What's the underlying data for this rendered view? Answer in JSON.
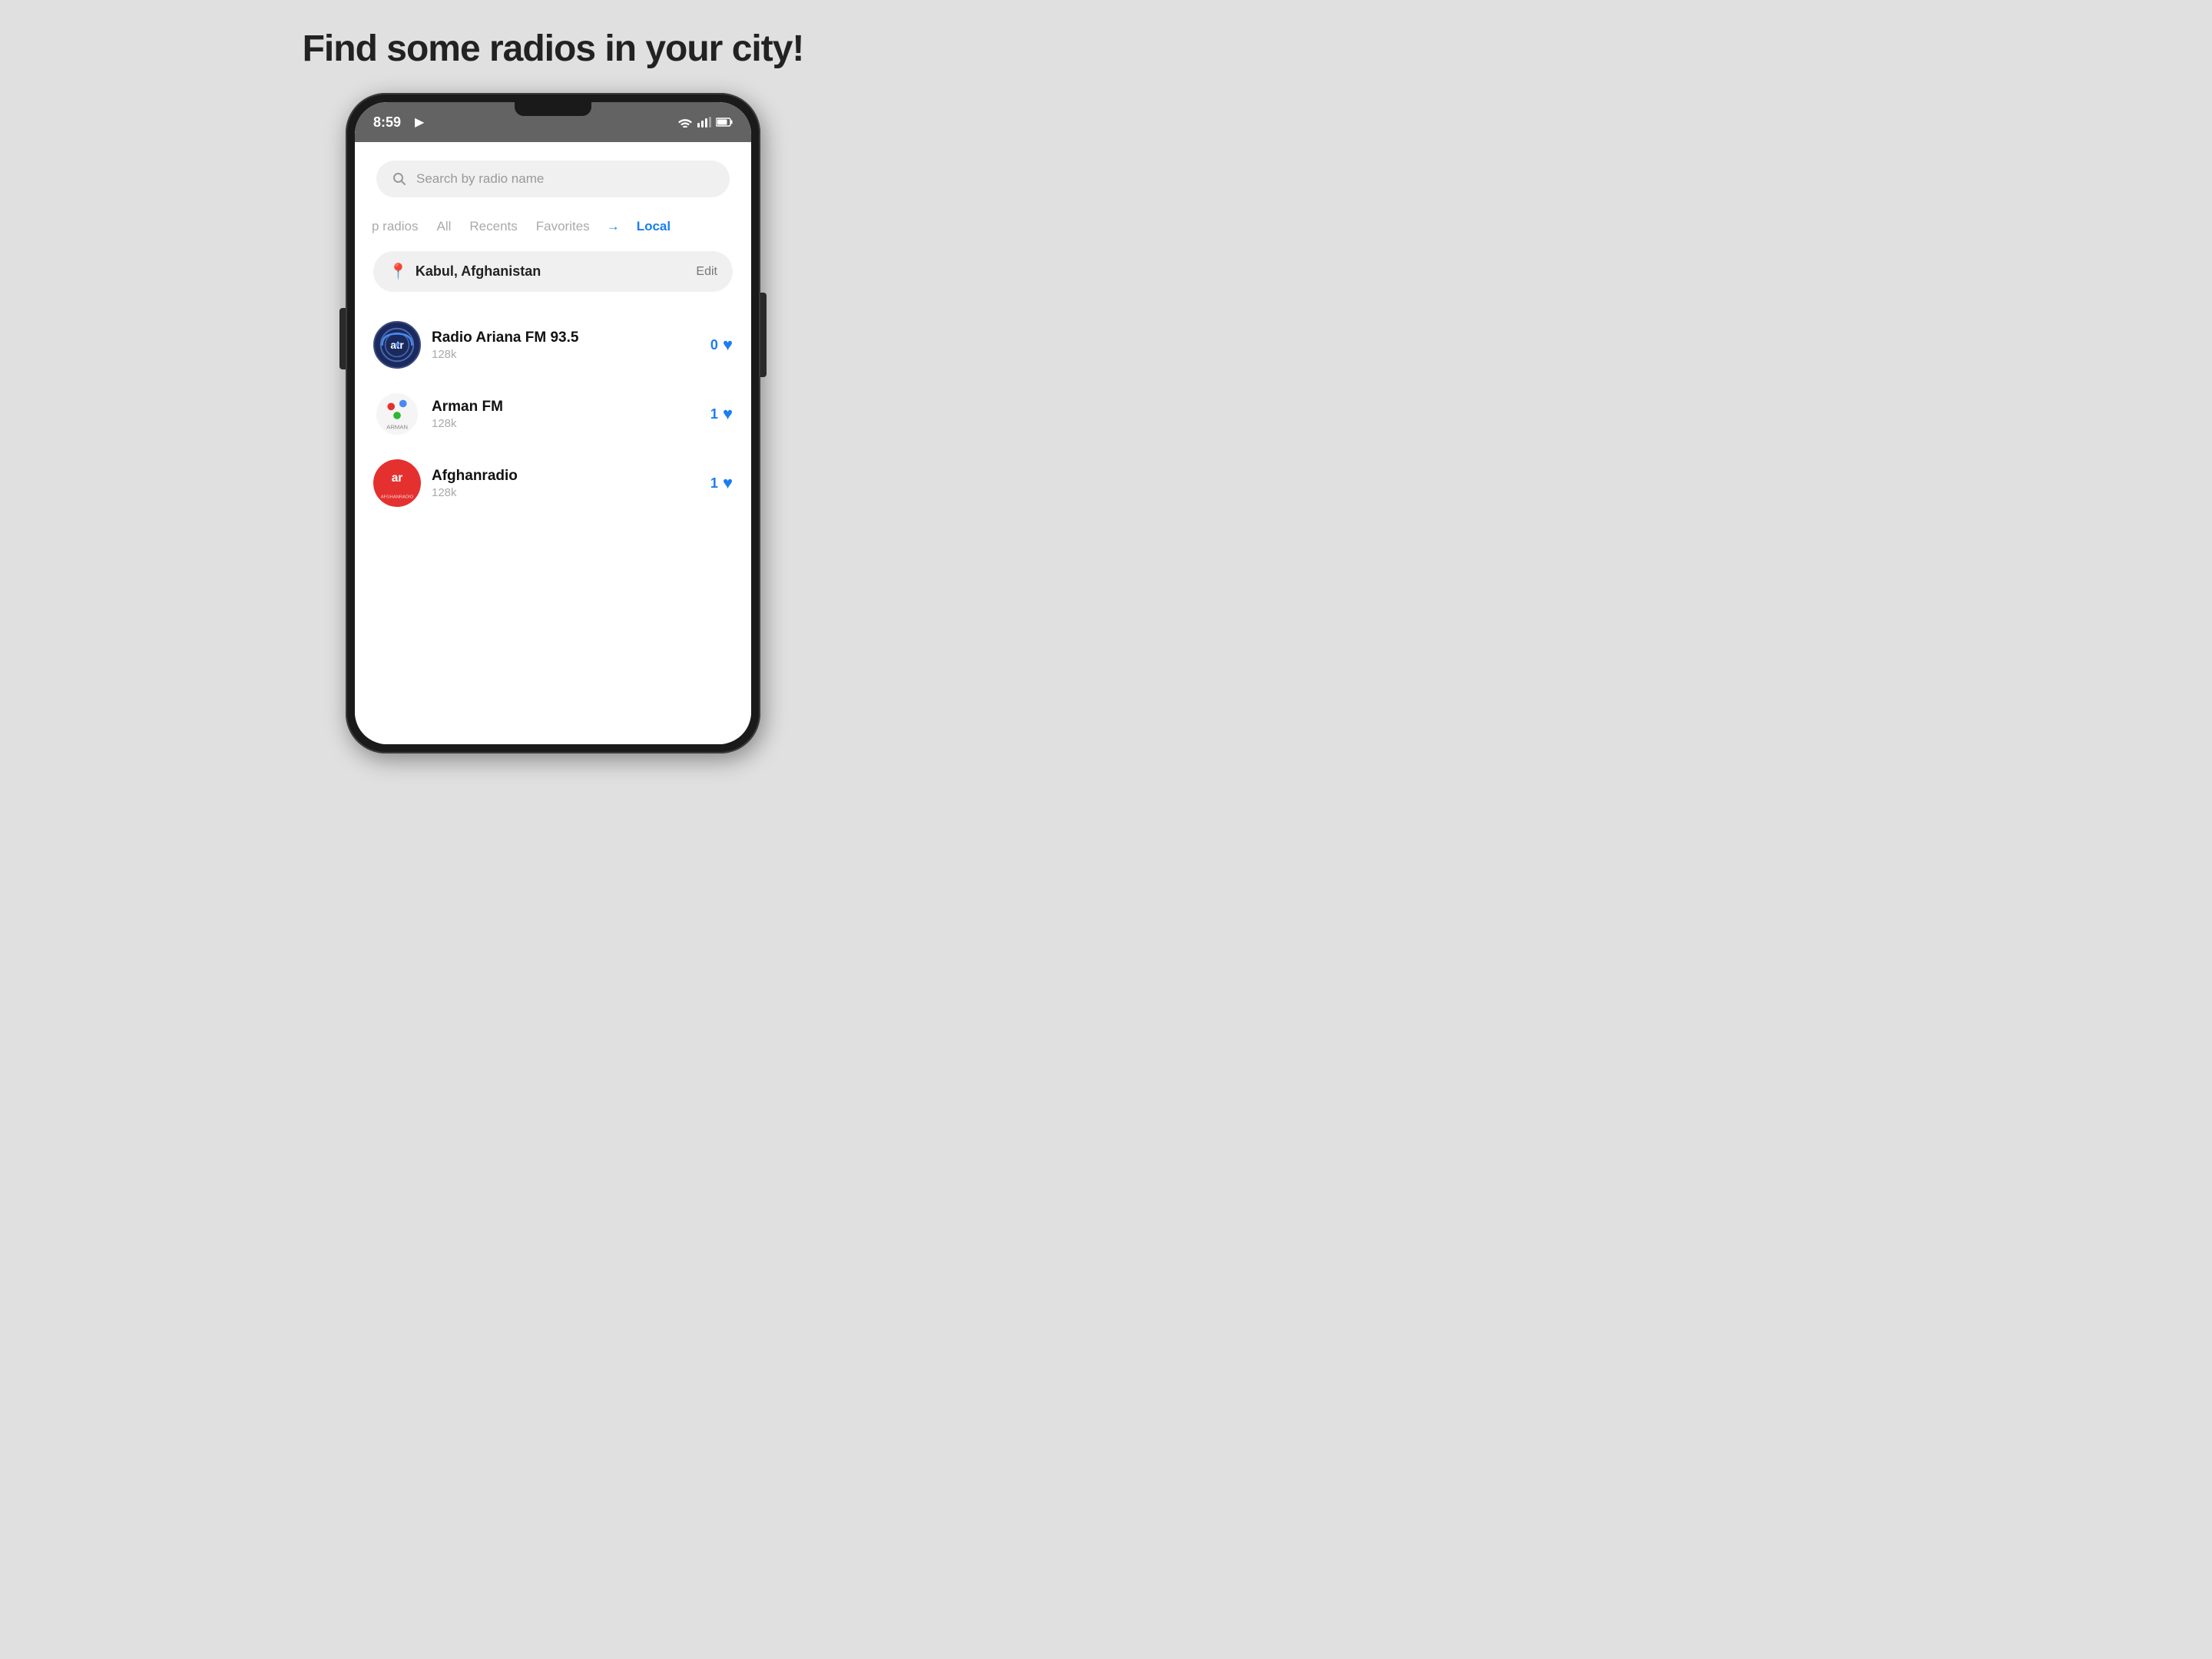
{
  "page": {
    "title": "Find some radios in your city!",
    "background_color": "#e0e0e0"
  },
  "status_bar": {
    "time": "8:59",
    "play_indicator": "▶"
  },
  "search": {
    "placeholder": "Search by radio name"
  },
  "tabs": [
    {
      "id": "top",
      "label": "p radios",
      "active": false
    },
    {
      "id": "all",
      "label": "All",
      "active": false
    },
    {
      "id": "recents",
      "label": "Recents",
      "active": false
    },
    {
      "id": "favorites",
      "label": "Favorites",
      "active": false
    },
    {
      "id": "local",
      "label": "Local",
      "active": true
    }
  ],
  "location": {
    "name": "Kabul, Afghanistan",
    "edit_label": "Edit"
  },
  "radios": [
    {
      "id": "ariana",
      "name": "Radio Ariana FM 93.5",
      "bitrate": "128k",
      "favorites": "0"
    },
    {
      "id": "arman",
      "name": "Arman FM",
      "bitrate": "128k",
      "favorites": "1"
    },
    {
      "id": "afghanradio",
      "name": "Afghanradio",
      "bitrate": "128k",
      "favorites": "1"
    }
  ]
}
